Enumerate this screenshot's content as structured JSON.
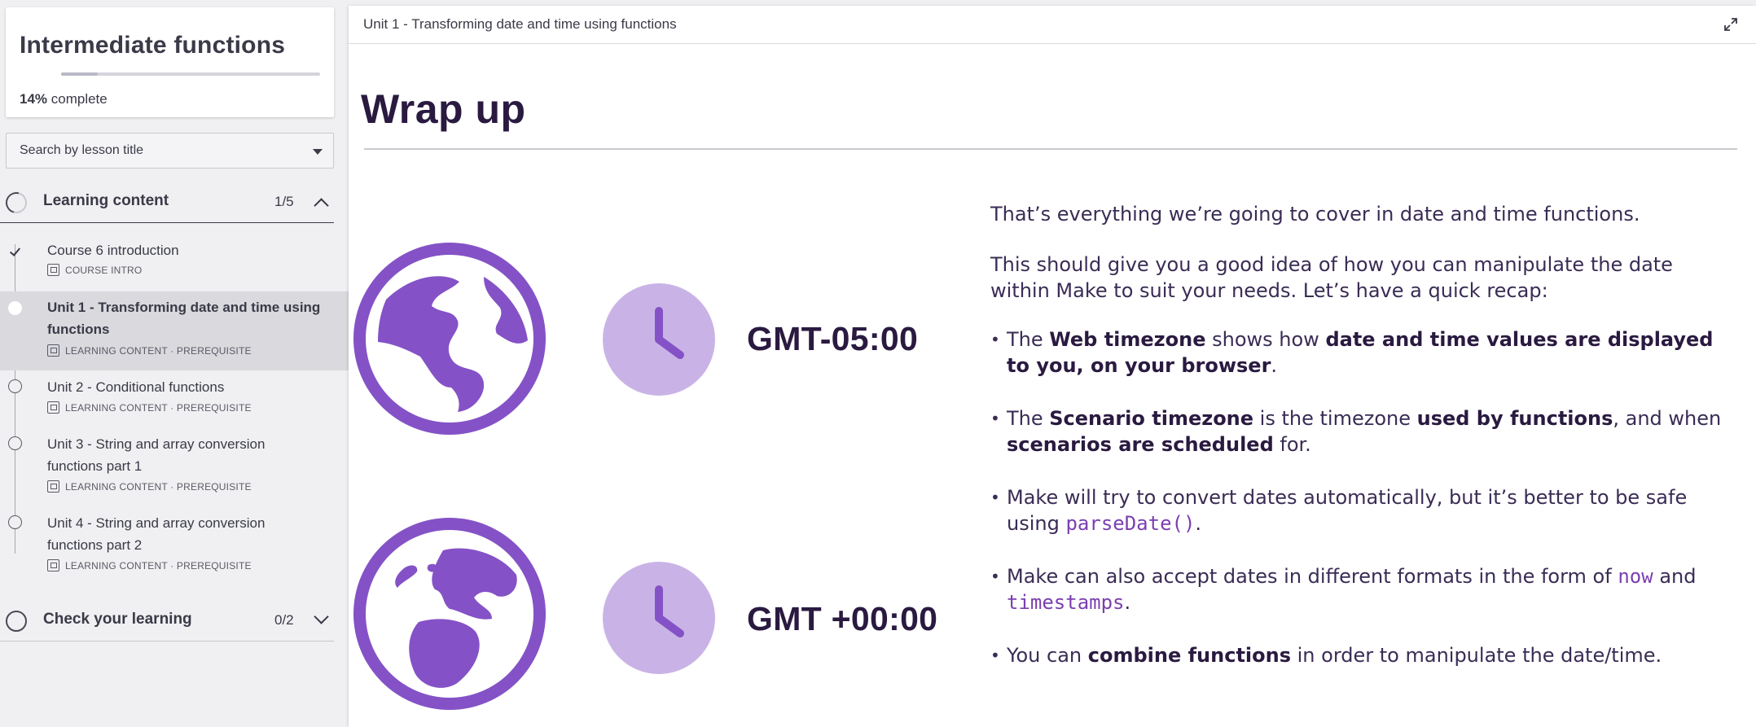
{
  "course": {
    "title": "Intermediate functions",
    "progress_percent": 14,
    "progress_label_value": "14%",
    "progress_label_suffix": " complete"
  },
  "search": {
    "placeholder": "Search by lesson title"
  },
  "sections": [
    {
      "title": "Learning content",
      "count": "1/5",
      "expanded": true,
      "lessons": [
        {
          "title": "Course 6 introduction",
          "meta": "COURSE INTRO",
          "status": "done",
          "active": false
        },
        {
          "title": "Unit 1 - Transforming date and time using functions",
          "meta": "LEARNING CONTENT · PREREQUISITE",
          "status": "current",
          "active": true
        },
        {
          "title": "Unit 2 - Conditional functions",
          "meta": "LEARNING CONTENT · PREREQUISITE",
          "status": "todo",
          "active": false
        },
        {
          "title": "Unit 3 - String and array conversion functions part 1",
          "meta": "LEARNING CONTENT · PREREQUISITE",
          "status": "todo",
          "active": false
        },
        {
          "title": "Unit 4 - String and array conversion functions part 2",
          "meta": "LEARNING CONTENT · PREREQUISITE",
          "status": "todo",
          "active": false
        }
      ]
    },
    {
      "title": "Check your learning",
      "count": "0/2",
      "expanded": false
    }
  ],
  "main": {
    "breadcrumb": "Unit 1 - Transforming date and time using functions",
    "page_title": "Wrap up",
    "gmt_top": "GMT-05:00",
    "gmt_bottom": "GMT +00:00",
    "intro_1": "That’s everything we’re going to cover in date and time functions.",
    "intro_2": "This should give you a good idea of how you can manipulate the date within Make to suit your needs. Let’s have a quick recap:",
    "b1": {
      "t1": "The ",
      "s1": "Web timezone",
      "t2": " shows how ",
      "s2": "date and time values are displayed to you, on your browser",
      "t3": "."
    },
    "b2": {
      "t1": "The ",
      "s1": "Scenario timezone",
      "t2": " is the timezone ",
      "s2": "used by functions",
      "t3": ", and when ",
      "s3": "scenarios are scheduled",
      "t4": " for."
    },
    "b3": {
      "t1": "Make will try to convert dates automatically, but it’s better to be safe using ",
      "c1": "parseDate()",
      "t2": "."
    },
    "b4": {
      "t1": "Make can also accept dates in different formats in the form of ",
      "c1": "now",
      "t2": " and ",
      "c2": "timestamps",
      "t3": "."
    },
    "b5": {
      "t1": "You can ",
      "s1": "combine functions",
      "t2": " in order to manipulate the date/time."
    }
  },
  "colors": {
    "accent_purple": "#8452c6",
    "clock_bg": "#c9b3e6",
    "title_dark": "#2a1a40"
  },
  "icons": [
    "chevron-down-icon",
    "chevron-up-icon",
    "expand-icon",
    "globe-icon",
    "clock-icon",
    "checkmark-icon",
    "lesson-type-icon"
  ]
}
